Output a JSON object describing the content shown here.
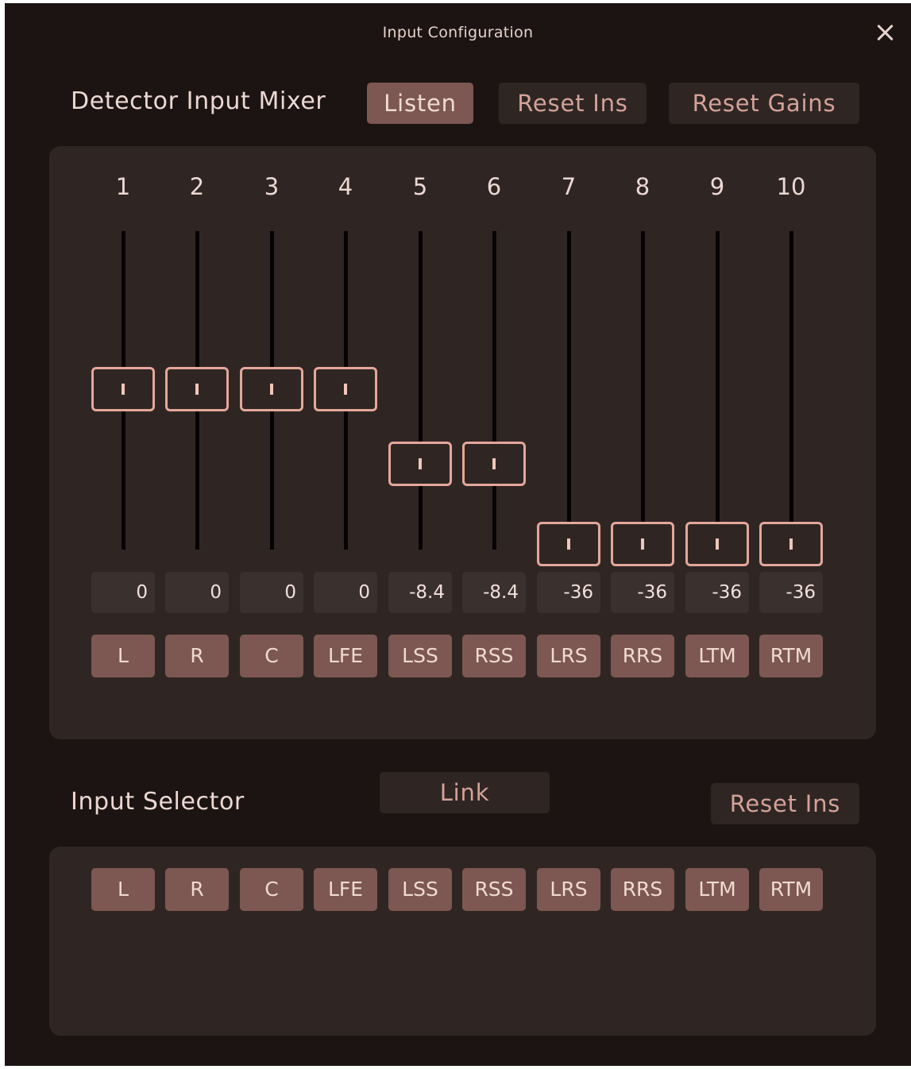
{
  "window": {
    "title": "Input Configuration"
  },
  "mixer": {
    "label": "Detector Input Mixer",
    "listen_label": "Listen",
    "reset_ins_label": "Reset Ins",
    "reset_gains_label": "Reset Gains",
    "channels": [
      {
        "number": "1",
        "value": "0",
        "name": "L"
      },
      {
        "number": "2",
        "value": "0",
        "name": "R"
      },
      {
        "number": "3",
        "value": "0",
        "name": "C"
      },
      {
        "number": "4",
        "value": "0",
        "name": "LFE"
      },
      {
        "number": "5",
        "value": "-8.4",
        "name": "LSS"
      },
      {
        "number": "6",
        "value": "-8.4",
        "name": "RSS"
      },
      {
        "number": "7",
        "value": "-36",
        "name": "LRS"
      },
      {
        "number": "8",
        "value": "-36",
        "name": "RRS"
      },
      {
        "number": "9",
        "value": "-36",
        "name": "LTM"
      },
      {
        "number": "10",
        "value": "-36",
        "name": "RTM"
      }
    ]
  },
  "selector": {
    "label": "Input Selector",
    "link_label": "Link",
    "reset_ins_label": "Reset Ins",
    "channels": [
      "L",
      "R",
      "C",
      "LFE",
      "LSS",
      "RSS",
      "LRS",
      "RRS",
      "LTM",
      "RTM"
    ]
  },
  "colors": {
    "background": "#1c1413",
    "panel": "#2f2624",
    "accent": "#7d5751",
    "knob_outline": "#e4a79a"
  }
}
